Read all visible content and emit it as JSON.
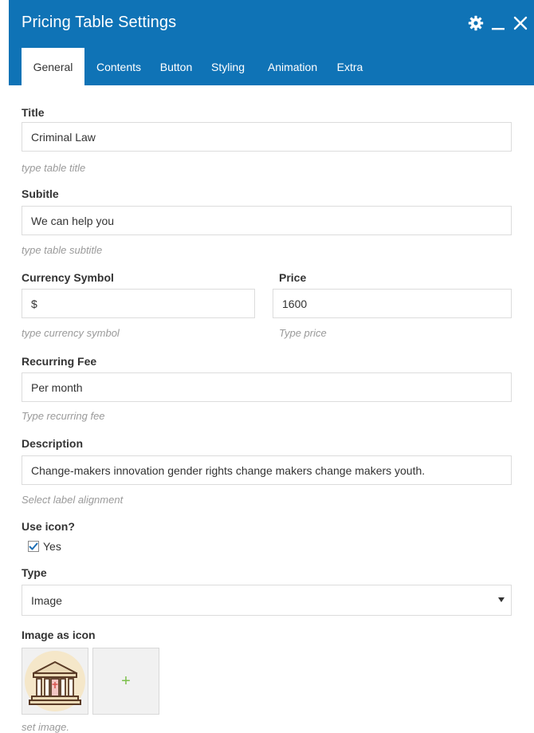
{
  "window": {
    "title": "Pricing Table Settings",
    "icons": [
      "gear-icon",
      "minimize-icon",
      "close-icon"
    ]
  },
  "tabs": [
    {
      "label": "General",
      "active": true
    },
    {
      "label": "Contents",
      "active": false
    },
    {
      "label": "Button",
      "active": false
    },
    {
      "label": "Styling",
      "active": false
    },
    {
      "label": "Animation",
      "active": false
    },
    {
      "label": "Extra",
      "active": false
    }
  ],
  "fields": {
    "title": {
      "label": "Title",
      "value": "Criminal Law",
      "hint": "type table title"
    },
    "subtitle": {
      "label": "Subitle",
      "value": "We can help you",
      "hint": "type table subtitle"
    },
    "currency": {
      "label": "Currency Symbol",
      "value": "$",
      "hint": "type currency symbol"
    },
    "price": {
      "label": "Price",
      "value": "1600",
      "hint": "Type price"
    },
    "recurring": {
      "label": "Recurring Fee",
      "value": "Per month",
      "hint": "Type recurring fee"
    },
    "description": {
      "label": "Description",
      "value": "Change-makers innovation gender rights change makers change makers youth.",
      "hint": "Select label alignment"
    },
    "use_icon": {
      "label": "Use icon?",
      "option_label": "Yes",
      "checked": true
    },
    "type": {
      "label": "Type",
      "selected": "Image"
    },
    "image_icon": {
      "label": "Image as icon",
      "hint": "set image.",
      "add_symbol": "+"
    }
  },
  "colors": {
    "header_bg": "#0f73b6",
    "accent_green": "#7cc04b",
    "hint_text": "#9a9a9a",
    "border": "#dcdcdc"
  }
}
